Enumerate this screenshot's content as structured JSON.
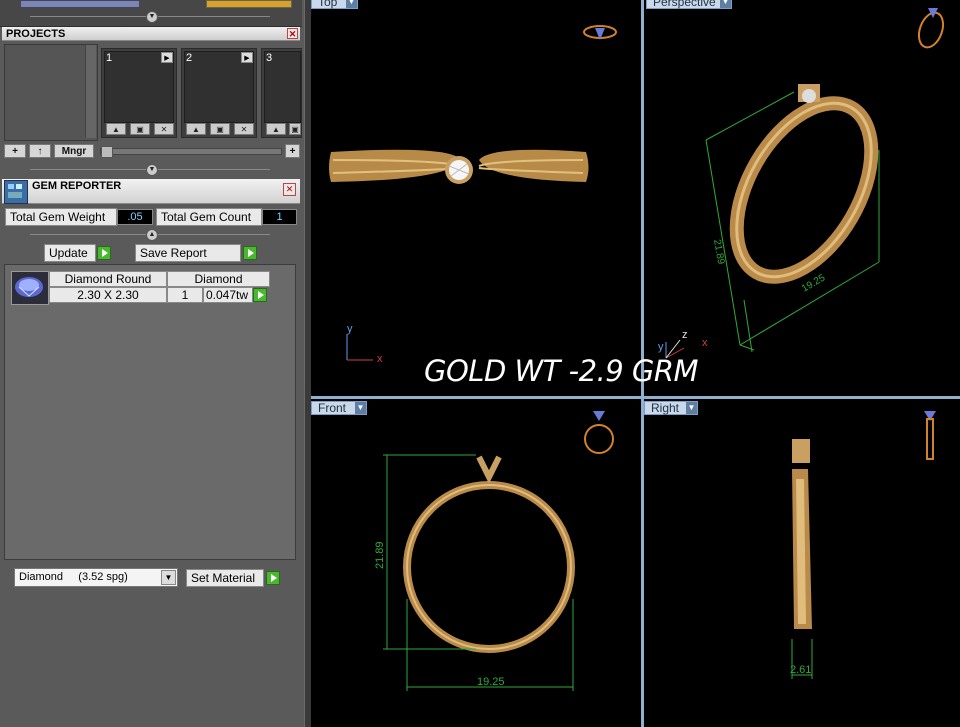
{
  "projects": {
    "title": "PROJECTS",
    "slots": [
      {
        "num": "1"
      },
      {
        "num": "2"
      },
      {
        "num": "3"
      }
    ],
    "buttons": {
      "add": "+",
      "up": "↑",
      "manager": "Mngr",
      "plus": "+"
    }
  },
  "gem_reporter": {
    "title": "GEM REPORTER",
    "total_weight_label": "Total Gem Weight",
    "total_weight_value": ".05",
    "total_count_label": "Total Gem Count",
    "total_count_value": "1",
    "update_label": "Update",
    "save_report_label": "Save Report",
    "table_headers": [
      "Diamond Round",
      "Diamond"
    ],
    "row": {
      "size": "2.30 X 2.30",
      "qty": "1",
      "weight": "0.047tw"
    },
    "material_select": "Diamond     (3.52 spg)",
    "set_material_label": "Set Material"
  },
  "viewports": {
    "top": {
      "label": "Top"
    },
    "perspective": {
      "label": "Perspective"
    },
    "front": {
      "label": "Front"
    },
    "right": {
      "label": "Right"
    }
  },
  "dimensions": {
    "front_height": "21.89",
    "front_width": "19.25",
    "persp_height": "21.89",
    "persp_width": "19.25",
    "right_width": "2.61"
  },
  "overlay_text": "GOLD WT -2.9 GRM",
  "axes": {
    "x": "x",
    "y": "y",
    "z": "z"
  },
  "colors": {
    "gold": "#c89a5a",
    "dim_line": "#2faa3a",
    "viewport_bg": "#000000",
    "accent": "#48b82e"
  }
}
